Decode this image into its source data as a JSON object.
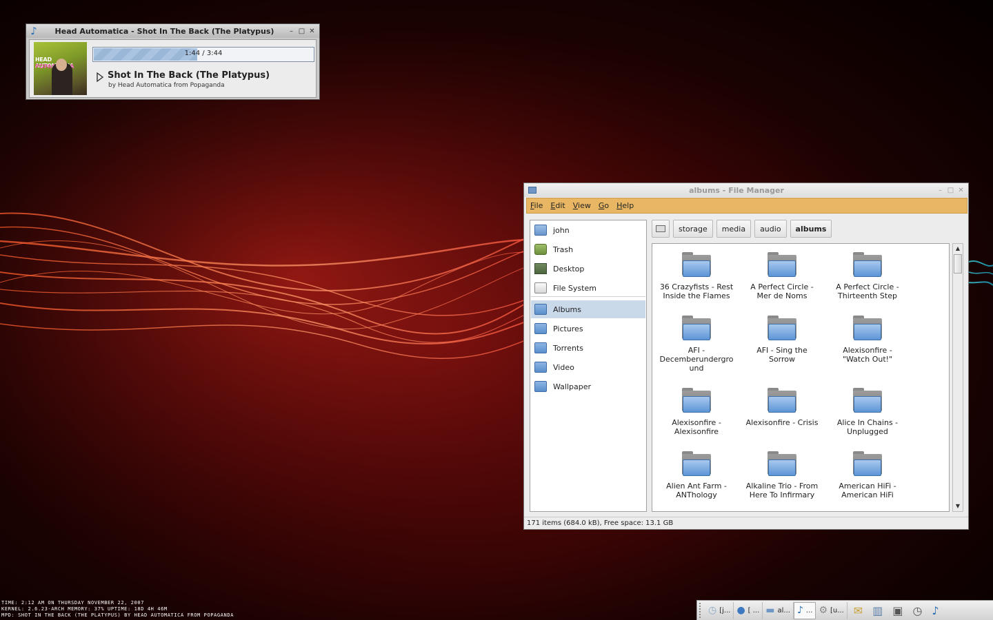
{
  "player": {
    "window_title": "Head Automatica - Shot In The Back (The Platypus)",
    "cover_artist": "HEAD AUTOMATICA",
    "cover_album": "POPAGANDA",
    "progress_text": "1:44 / 3:44",
    "progress_fraction": 0.47,
    "song_title": "Shot In The Back (The Platypus)",
    "byline": "by Head Automatica from Popaganda"
  },
  "file_manager": {
    "window_title": "albums - File Manager",
    "menu": [
      "File",
      "Edit",
      "View",
      "Go",
      "Help"
    ],
    "menu_mnemonics": [
      "F",
      "E",
      "V",
      "G",
      "H"
    ],
    "sidebar": [
      {
        "label": "john",
        "icon": "home-folder-icon"
      },
      {
        "label": "Trash",
        "icon": "trash-icon"
      },
      {
        "label": "Desktop",
        "icon": "desktop-icon"
      },
      {
        "label": "File System",
        "icon": "drive-icon"
      },
      {
        "label": "Albums",
        "icon": "folder-icon",
        "selected": true
      },
      {
        "label": "Pictures",
        "icon": "folder-icon"
      },
      {
        "label": "Torrents",
        "icon": "folder-icon"
      },
      {
        "label": "Video",
        "icon": "folder-icon"
      },
      {
        "label": "Wallpaper",
        "icon": "folder-icon"
      }
    ],
    "path": [
      "storage",
      "media",
      "audio",
      "albums"
    ],
    "folders": [
      "36 Crazyfists - Rest Inside the Flames",
      "A Perfect Circle - Mer de Noms",
      "A Perfect Circle - Thirteenth Step",
      "AFI - Decemberunderground",
      "AFI - Sing the Sorrow",
      "Alexisonfire - \"Watch Out!\"",
      "Alexisonfire - Alexisonfire",
      "Alexisonfire - Crisis",
      "Alice In Chains - Unplugged",
      "Alien Ant Farm - ANThology",
      "Alkaline Trio - From Here To Infirmary",
      "American HiFi - American HiFi"
    ],
    "status": "171 items (684.0 kB), Free space: 13.1 GB"
  },
  "conky": {
    "line1": "Time:  2:12 AM on Thursday November 22, 2007",
    "line2": "Kernel: 2.6.23-ARCH    Memory: 37%    Uptime: 18d 4h 46m",
    "line3": "MPD: Shot In The Back (The Platypus) by Head Automatica from Popaganda"
  },
  "taskbar": {
    "tasks": [
      {
        "label": "[j...",
        "icon": "clock-icon"
      },
      {
        "label": "[ ...",
        "icon": "globe-icon"
      },
      {
        "label": "al...",
        "icon": "folder-icon"
      },
      {
        "label": "...",
        "icon": "music-note-icon",
        "active": true
      },
      {
        "label": "[u...",
        "icon": "gear-icon"
      }
    ],
    "tray_icons": [
      "mail-icon",
      "pager-icon",
      "window-list-icon",
      "clock-icon",
      "music-note-icon"
    ]
  },
  "colors": {
    "menubar": "#e9b764",
    "folder_blue": "#5d95d6",
    "selection": "#c9d9ea"
  }
}
